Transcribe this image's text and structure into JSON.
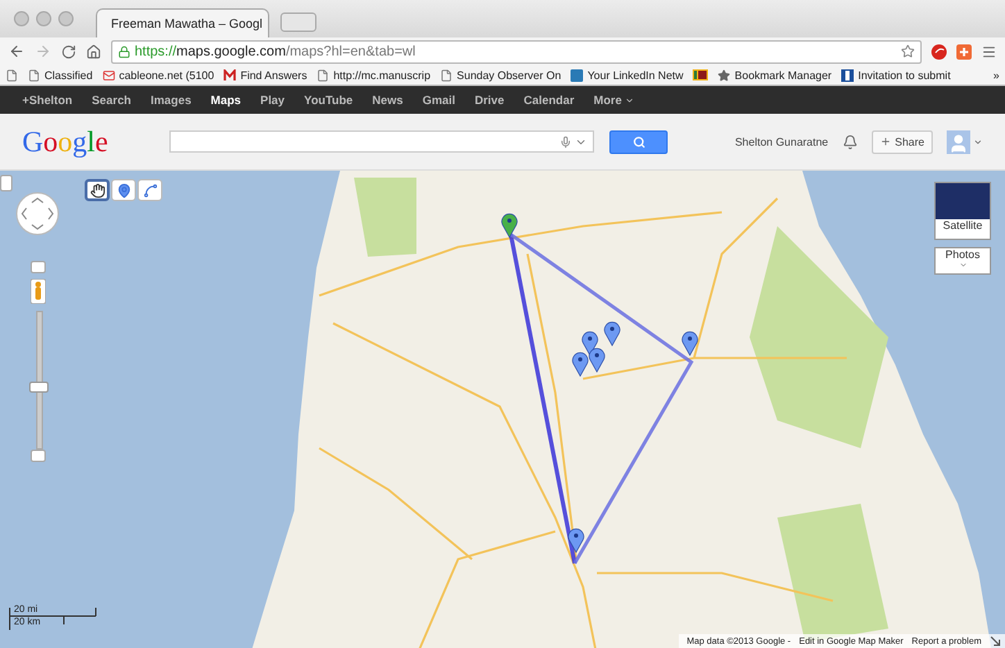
{
  "browser": {
    "tab_title": "Freeman Mawatha – Googl",
    "url": {
      "scheme": "https://",
      "host": "maps.google.com",
      "path": "/maps?hl=en&tab=wl"
    },
    "bookmarks": [
      {
        "label": "Classified",
        "kind": "page"
      },
      {
        "label": "cableone.net (5100",
        "kind": "mail"
      },
      {
        "label": "Find Answers",
        "kind": "mark"
      },
      {
        "label": "http://mc.manuscrip",
        "kind": "page"
      },
      {
        "label": "Sunday Observer On",
        "kind": "page"
      },
      {
        "label": "Your LinkedIn Netw",
        "kind": "linkedin"
      },
      {
        "kind": "flag"
      },
      {
        "label": "Bookmark Manager",
        "kind": "star"
      },
      {
        "label": "Invitation to submit",
        "kind": "square"
      }
    ],
    "more_bookmarks": "»"
  },
  "google_bar": [
    {
      "label": "+Shelton",
      "selected": false
    },
    {
      "label": "Search",
      "selected": false
    },
    {
      "label": "Images",
      "selected": false
    },
    {
      "label": "Maps",
      "selected": true
    },
    {
      "label": "Play",
      "selected": false
    },
    {
      "label": "YouTube",
      "selected": false
    },
    {
      "label": "News",
      "selected": false
    },
    {
      "label": "Gmail",
      "selected": false
    },
    {
      "label": "Drive",
      "selected": false
    },
    {
      "label": "Calendar",
      "selected": false
    },
    {
      "label": "More",
      "selected": false
    }
  ],
  "header": {
    "logo": "Google",
    "user_name": "Shelton Gunaratne",
    "share": "Share"
  },
  "map": {
    "tools": [
      {
        "kind": "hand",
        "selected": true
      },
      {
        "kind": "pin",
        "selected": false
      },
      {
        "kind": "line",
        "selected": false
      }
    ],
    "zoom": {
      "level": 0.45
    },
    "satellite": "Satellite",
    "photos": "Photos",
    "scale": [
      "20 mi",
      "20 km"
    ],
    "footer": [
      "Map data ©2013 Google -",
      "Edit in Google Map Maker",
      "Report a problem"
    ]
  }
}
